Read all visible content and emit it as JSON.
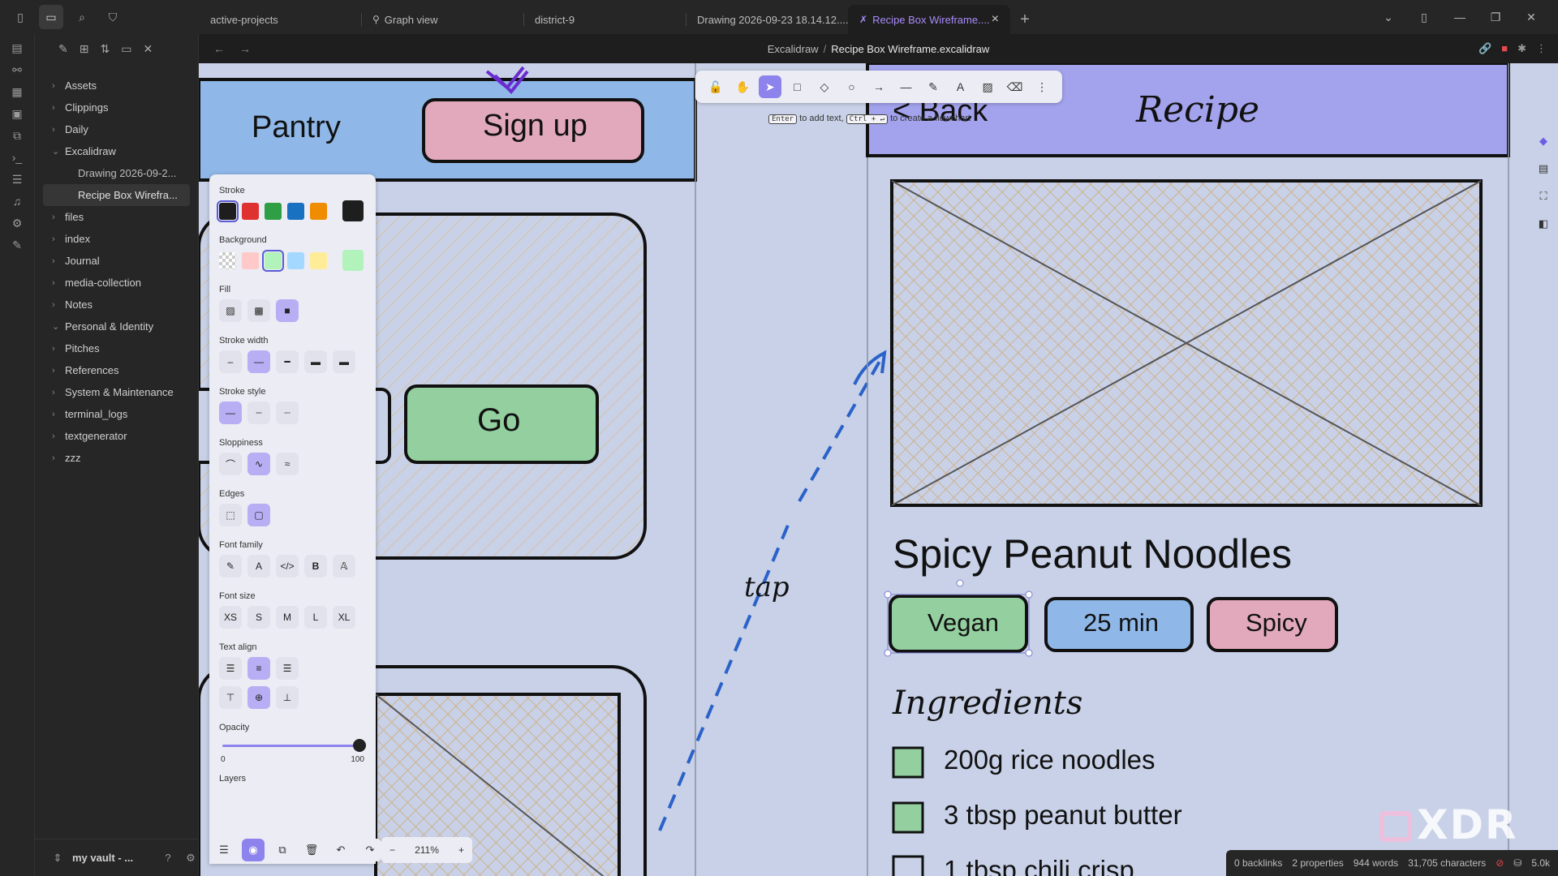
{
  "tabs": [
    {
      "label": "active-projects"
    },
    {
      "label": "Graph view"
    },
    {
      "label": "district-9"
    },
    {
      "label": "Drawing 2026-09-23 18.14.12...."
    },
    {
      "label": "Recipe Box Wireframe...."
    }
  ],
  "explorer": {
    "items": [
      {
        "label": "Assets"
      },
      {
        "label": "Clippings"
      },
      {
        "label": "Daily"
      },
      {
        "label": "Excalidraw"
      },
      {
        "label": "Drawing 2026-09-2..."
      },
      {
        "label": "Recipe Box Wirefra..."
      },
      {
        "label": "files"
      },
      {
        "label": "index"
      },
      {
        "label": "Journal"
      },
      {
        "label": "media-collection"
      },
      {
        "label": "Notes"
      },
      {
        "label": "Personal & Identity"
      },
      {
        "label": "Pitches"
      },
      {
        "label": "References"
      },
      {
        "label": "System & Maintenance"
      },
      {
        "label": "terminal_logs"
      },
      {
        "label": "textgenerator"
      },
      {
        "label": "zzz"
      }
    ],
    "vault_name": "my vault - ..."
  },
  "breadcrumb": {
    "folder": "Excalidraw",
    "separator": "/",
    "file": "Recipe Box Wireframe.excalidraw"
  },
  "canvas": {
    "left_screen": {
      "header": "Pantry",
      "signup": "Sign up",
      "go": "Go"
    },
    "right_screen": {
      "back": "< Back",
      "header": "Recipe",
      "title": "Spicy Peanut Noodles",
      "tags": [
        "Vegan",
        "25 min",
        "Spicy"
      ],
      "ingredients_heading": "Ingredients",
      "ingredients": [
        "200g rice noodles",
        "3 tbsp peanut butter",
        "1 tbsp chili crisp"
      ]
    },
    "arrow_label": "tap"
  },
  "toolbar": {
    "hint_key1": "Enter",
    "hint_text1": "to add text,",
    "hint_key2": "Ctrl + ↵",
    "hint_text2": "to create a flowchart"
  },
  "props": {
    "stroke": "Stroke",
    "background": "Background",
    "fill": "Fill",
    "stroke_width": "Stroke width",
    "stroke_style": "Stroke style",
    "sloppiness": "Sloppiness",
    "edges": "Edges",
    "font_family": "Font family",
    "font_size": "Font size",
    "font_sizes": [
      "XS",
      "S",
      "M",
      "L",
      "XL"
    ],
    "text_align": "Text align",
    "opacity": "Opacity",
    "opacity_min": "0",
    "opacity_max": "100",
    "opacity_value": 100,
    "layers": "Layers",
    "stroke_colors": [
      "#1e1e1e",
      "#e03131",
      "#2f9e44",
      "#1971c2",
      "#f08c00"
    ],
    "bg_colors": [
      "transparent",
      "#ffc9c9",
      "#b2f2bb",
      "#a5d8ff",
      "#ffec99"
    ],
    "current_stroke": "#1e1e1e",
    "current_bg": "#b2f2bb"
  },
  "zoom": {
    "level": "211%",
    "minus": "−",
    "plus": "+"
  },
  "status": {
    "backlinks": "0 backlinks",
    "properties": "2 properties",
    "words": "944 words",
    "chars": "31,705 characters",
    "size": "5.0k"
  },
  "watermark": "XDR"
}
